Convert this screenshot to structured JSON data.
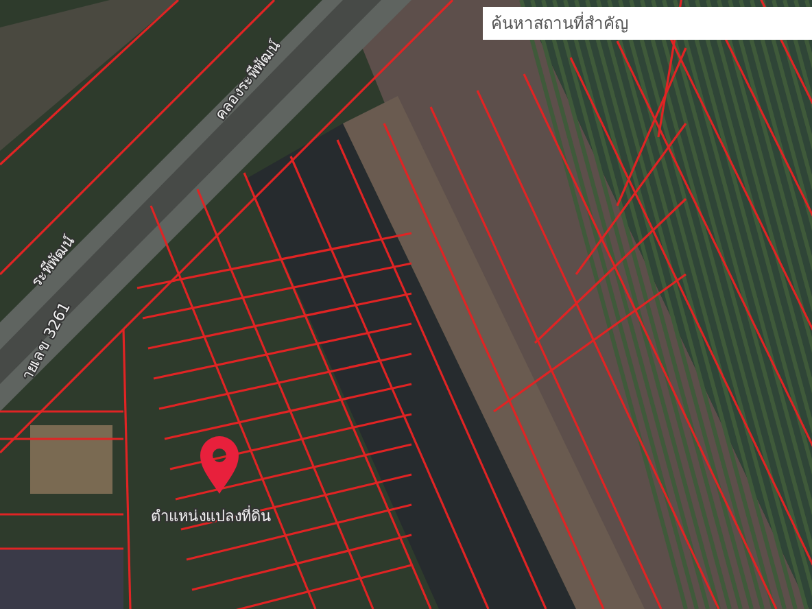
{
  "search": {
    "placeholder": "ค้นหาสถานที่สำคัญ"
  },
  "map": {
    "labels": [
      "คลองระพีพัฒน์",
      "ระพีพัฒน์",
      "ายเลข 3261"
    ],
    "marker": {
      "label": "ตำแหน่งแปลงที่ดิน"
    }
  }
}
